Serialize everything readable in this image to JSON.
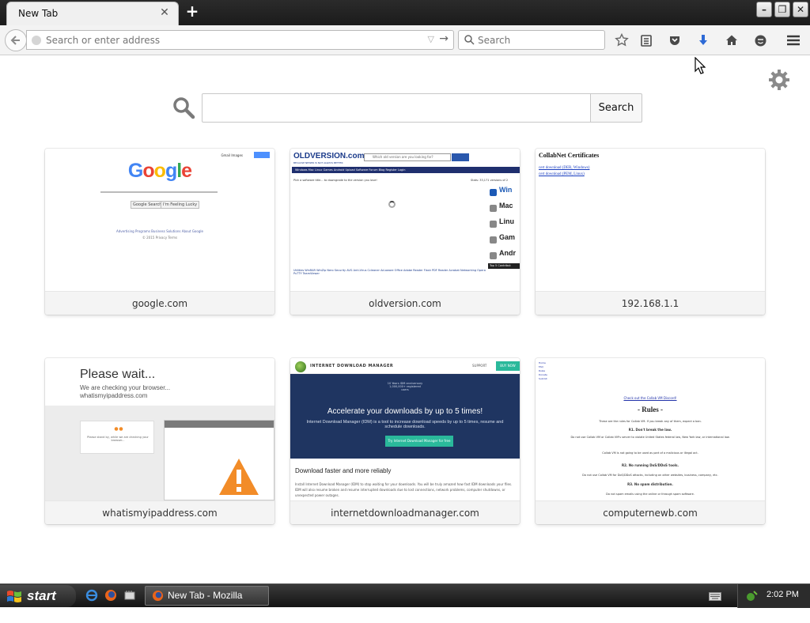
{
  "browser": {
    "tab": {
      "title": "New Tab"
    },
    "urlbar": {
      "placeholder": "Search or enter address"
    },
    "searchbar": {
      "placeholder": "Search"
    }
  },
  "page": {
    "search_button_label": "Search",
    "tiles": [
      {
        "label": "google.com",
        "thumb": {
          "logo": "Google",
          "top_links": "Gmail Images",
          "btn1": "Google Search",
          "btn2": "I'm Feeling Lucky",
          "bottom_links": "Advertising Programs   Business Solutions   About Google",
          "copyright": "© 2015 Privacy Terms"
        }
      },
      {
        "label": "oldversion.com",
        "thumb": {
          "logo": "OLDVERSION.com",
          "tagline": "BECAUSE NEWER IS NOT ALWAYS BETTER",
          "search_placeholder": "Which old version are you looking for?",
          "nav": "Windows   Mac   Linux   Games   Android        Upload Software   Forum   Blog   Register   Login",
          "pick": "Pick a software title... to downgrade to the version you love!",
          "stats": "Stats: 33,171 versions of 2",
          "side": [
            "Win",
            "Mac",
            "Linu",
            "Gam",
            "Andr"
          ],
          "top5": "Top 5 Contribut",
          "cols": "Utilities  WinRAR  WinZip  Nero      Security  AVG Anti-Virus  Ccleaner  Ad-aware      Office  Adobe Reader  Flash PDF Reader  Acrobat      Networking  Opera  PuTTY  TeamViewer"
        }
      },
      {
        "label": "192.168.1.1",
        "thumb": {
          "title": "CollabNet Certificates",
          "link1": "cert download (DER, Windows)",
          "link2": "cert download (PEM, Linux)"
        }
      },
      {
        "label": "whatismyipaddress.com",
        "thumb": {
          "title": "Please wait...",
          "sub1": "We are checking your browser...",
          "sub2": "whatismyipaddress.com",
          "card_text": "Please stand by, while we are checking your browser..."
        }
      },
      {
        "label": "internetdownloadmanager.com",
        "thumb": {
          "name": "INTERNET DOWNLOAD MANAGER",
          "support": "SUPPORT",
          "buy": "BUY NOW",
          "award": "10 Years IDM anniversary 1,000,000+ registered users",
          "headline": "Accelerate your downloads by up to 5 times!",
          "desc": "Internet Download Manager (IDM) is a tool to increase download speeds by up to 5 times, resume and schedule downloads.",
          "cta": "Try Internet Download Manager for free",
          "subheading": "Download faster and more reliably",
          "body": "Install Internet Download Manager (IDM) to stop waiting for your downloads. You will be truly amazed how fast IDM downloads your files. IDM will also resume broken and resume interrupted downloads due to lost connections, network problems, computer shutdowns, or unexpected power outages."
        }
      },
      {
        "label": "computernewb.com",
        "thumb": {
          "nav": [
            "Home",
            "FAQ",
            "Rules",
            "Donate",
            "Submit"
          ],
          "banner": "Check out the Collab VM Discord!",
          "rules_title": "- Rules -",
          "lines": [
            "These are the rules for Collab VM. If you break any of them, expect a ban.",
            "R1. Don't break the law.",
            "Do not use Collab VM or Collab VM's server to violate United States federal law, New York law, or international law.",
            "Collab VM is not going to be used as part of a malicious or illegal act.",
            "R2. No running DoS/DDoS tools.",
            "Do not use Collab VM for DoS/DDoS attacks, including on other websites, business, company, etc.",
            "R3. No spam distribution.",
            "Do not spam emails using the online or through spam software."
          ]
        }
      }
    ]
  },
  "taskbar": {
    "start_label": "start",
    "task_label": "New Tab - Mozilla Fire...",
    "clock": "2:02 PM"
  },
  "colors": {
    "download_arrow": "#2d6ad6",
    "warning": "#f28c28",
    "idm_hero": "#1f3561",
    "idm_accent": "#2ab99b"
  }
}
